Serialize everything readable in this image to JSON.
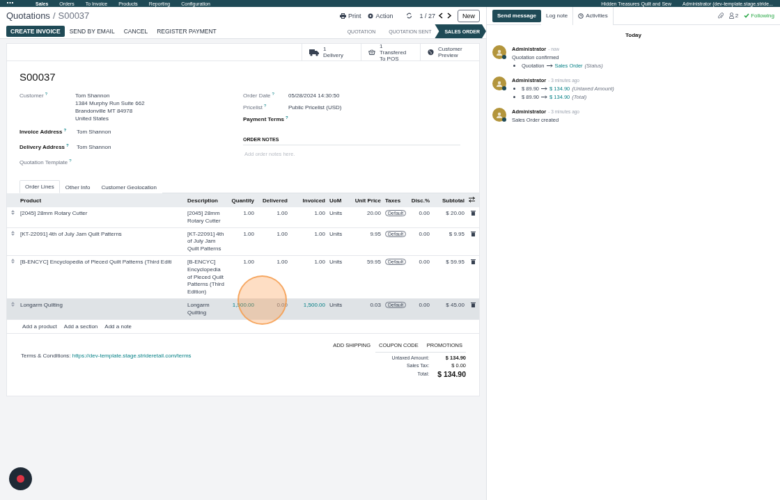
{
  "top_nav": {
    "app": "Sales",
    "menu": [
      "Orders",
      "To Invoice",
      "Products",
      "Reporting",
      "Configuration"
    ],
    "company": "Hidden Treasures Quilt and Sew",
    "user": "Administrator (dev-template.stage.stride..."
  },
  "breadcrumb": {
    "parent": "Quotations",
    "separator": "/",
    "current": "S00037"
  },
  "toolbar": {
    "print": "Print",
    "action": "Action",
    "pager": "1 / 27",
    "new": "New"
  },
  "actions": [
    {
      "label": "CREATE INVOICE",
      "primary": true
    },
    {
      "label": "SEND BY EMAIL",
      "primary": false
    },
    {
      "label": "CANCEL",
      "primary": false
    },
    {
      "label": "REGISTER PAYMENT",
      "primary": false
    }
  ],
  "stages": [
    {
      "label": "QUOTATION",
      "selected": false
    },
    {
      "label": "QUOTATION SENT",
      "selected": false
    },
    {
      "label": "SALES ORDER",
      "selected": true
    }
  ],
  "smart_buttons": [
    {
      "kind": "truck",
      "value": "1",
      "label": "Delivery"
    },
    {
      "kind": "basket",
      "value": "1",
      "label": "Transfered To POS"
    },
    {
      "kind": "globe",
      "label": "Customer Preview"
    }
  ],
  "title": "S00037",
  "left_fields": [
    {
      "label": "Customer",
      "hint": "?",
      "bold": false,
      "lines": [
        "Tom Shannon",
        "1384 Murphy Run Suite 662",
        "Brandonville MT 84978",
        "United States"
      ]
    },
    {
      "label": "Invoice Address",
      "hint": "?",
      "bold": true,
      "lines": [
        "Tom Shannon"
      ]
    },
    {
      "label": "Delivery Address",
      "hint": "?",
      "bold": true,
      "lines": [
        "Tom Shannon"
      ]
    },
    {
      "label": "Quotation Template",
      "hint": "?",
      "bold": false
    }
  ],
  "right_fields": [
    {
      "label": "Order Date",
      "hint": "?",
      "bold": false,
      "value": "05/28/2024 14:30:50"
    },
    {
      "label": "Pricelist",
      "hint": "?",
      "bold": false,
      "value": "Public Pricelist (USD)"
    },
    {
      "label": "Payment Terms",
      "hint": "?",
      "bold": true
    }
  ],
  "order_notes": {
    "title": "ORDER NOTES",
    "placeholder": "Add order notes here."
  },
  "tabs": [
    {
      "label": "Order Lines",
      "selected": true
    },
    {
      "label": "Other Info",
      "selected": false
    },
    {
      "label": "Customer Geolocation",
      "selected": false
    }
  ],
  "columns": [
    "Product",
    "Description",
    "Quantity",
    "Delivered",
    "Invoiced",
    "UoM",
    "Unit Price",
    "Taxes",
    "Disc.%",
    "Subtotal"
  ],
  "rows": [
    {
      "product": "[2045] 28mm Rotary Cutter",
      "description": "[2045] 28mm Rotary Cutter",
      "quantity": "1.00",
      "delivered": "1.00",
      "invoiced": "1.00",
      "uom": "Units",
      "unit_price": "20.00",
      "tax": "Default",
      "discount": "0.00",
      "subtotal": "$ 20.00",
      "selected": false
    },
    {
      "product": "[KT-22091] 4th of July Jam Quilt Patterns",
      "description": "[KT-22091] 4th of July Jam Quilt Patterns",
      "quantity": "1.00",
      "delivered": "1.00",
      "invoiced": "1.00",
      "uom": "Units",
      "unit_price": "9.95",
      "tax": "Default",
      "discount": "0.00",
      "subtotal": "$ 9.95",
      "selected": false
    },
    {
      "product": "[B-ENCYC] Encyclopedia of Pieced Quilt Patterns (Third Editi",
      "description": "[B-ENCYC] Encyclopedia of Pieced Quilt Patterns (Third Edition)",
      "quantity": "1.00",
      "delivered": "1.00",
      "invoiced": "1.00",
      "uom": "Units",
      "unit_price": "59.95",
      "tax": "Default",
      "discount": "0.00",
      "subtotal": "$ 59.95",
      "selected": false
    },
    {
      "product": "Longarm Quilting",
      "description": "Longarm Quilting",
      "quantity": "1,500.00",
      "delivered": "0.00",
      "invoiced": "1,500.00",
      "uom": "Units",
      "unit_price": "0.03",
      "tax": "Default",
      "discount": "0.00",
      "subtotal": "$ 45.00",
      "selected": true
    }
  ],
  "add_links": [
    "Add a product",
    "Add a section",
    "Add a note"
  ],
  "terms": {
    "label": "Terms & Conditions:",
    "link": "https://dev-template.stage.strideretail.com/terms"
  },
  "footer_buttons": [
    "ADD SHIPPING",
    "COUPON CODE",
    "PROMOTIONS"
  ],
  "totals": [
    {
      "label": "Untaxed Amount:",
      "value": "$ 134.90",
      "kind": "bold"
    },
    {
      "label": "Sales Tax:",
      "value": "$ 0.00",
      "kind": "plain"
    },
    {
      "label": "Total:",
      "value": "$ 134.90",
      "kind": "grand"
    }
  ],
  "chatter": {
    "buttons": [
      {
        "label": "Send message",
        "selected": true
      },
      {
        "label": "Log note",
        "selected": false
      },
      {
        "label": "Activities",
        "selected": false
      }
    ],
    "followers": "2",
    "following": "Following",
    "day": "Today",
    "messages": [
      {
        "author": "Administrator",
        "time": "- now",
        "body": "Quotation confirmed",
        "changes": [
          {
            "from": "Quotation",
            "to": "Sales Order",
            "field": "(Status)"
          }
        ]
      },
      {
        "author": "Administrator",
        "time": "- 3 minutes ago",
        "changes": [
          {
            "from": "$ 89.90",
            "to": "$ 134.90",
            "field": "(Untaxed Amount)"
          },
          {
            "from": "$ 89.90",
            "to": "$ 134.90",
            "field": "(Total)"
          }
        ]
      },
      {
        "author": "Administrator",
        "time": "- 3 minutes ago",
        "body": "Sales Order created"
      }
    ]
  }
}
